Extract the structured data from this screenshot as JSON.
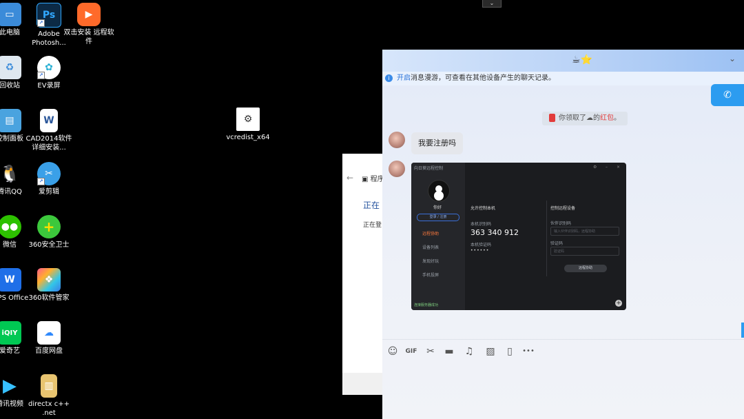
{
  "desktop": {
    "icons": [
      {
        "label": "此电脑",
        "icon": "computer-icon"
      },
      {
        "label": "Adobe Photosh...",
        "icon": "photoshop-icon"
      },
      {
        "label": "双击安装 远程软件",
        "icon": "remote-install-icon"
      },
      {
        "label": "回收站",
        "icon": "recycle-bin-icon"
      },
      {
        "label": "EV录屏",
        "icon": "ev-recorder-icon"
      },
      {
        "label": "控制面板",
        "icon": "control-panel-icon"
      },
      {
        "label": "CAD2014软件详细安装...",
        "icon": "word-doc-icon"
      },
      {
        "label": "vcredist_x64",
        "icon": "installer-icon"
      },
      {
        "label": "腾讯QQ",
        "icon": "qq-icon"
      },
      {
        "label": "爱剪辑",
        "icon": "video-editor-icon"
      },
      {
        "label": "微信",
        "icon": "wechat-icon"
      },
      {
        "label": "360安全卫士",
        "icon": "360-security-icon"
      },
      {
        "label": "WPS Office",
        "icon": "wps-icon"
      },
      {
        "label": "360软件管家",
        "icon": "360-software-icon"
      },
      {
        "label": "爱奇艺",
        "icon": "iqiyi-icon"
      },
      {
        "label": "百度网盘",
        "icon": "baidu-netdisk-icon"
      },
      {
        "label": "腾讯视频",
        "icon": "tencent-video-icon"
      },
      {
        "label": "directx c++ .net",
        "icon": "folder-archive-icon"
      }
    ]
  },
  "installer": {
    "title_fragment": "程序",
    "heading_fragment": "正在",
    "status_fragment": "正在登"
  },
  "chat": {
    "header_icons": "☕⭐",
    "notice": {
      "link": "开启",
      "text": "消息漫游，可查看在其他设备产生的聊天记录。"
    },
    "system_message": {
      "prefix": "你领取了",
      "suffix": "的",
      "red": "红包",
      "end": "。"
    },
    "message_text": "我要注册吗",
    "toolbar": [
      "emoji-icon",
      "gif-icon",
      "scissors-icon",
      "folder-icon",
      "music-icon",
      "image-icon",
      "screen-share-icon",
      "more-icon"
    ],
    "toolbar_labels": {
      "gif": "GIF",
      "more": "•••"
    }
  },
  "shared_screenshot": {
    "app_title": "向日葵远程控制",
    "greeting": "你好",
    "login_label": "登录 / 注册",
    "menu": [
      "远程协助",
      "设备列表",
      "发现好玩",
      "手机投屏"
    ],
    "allow_title": "允许控制本机",
    "id_label": "本机识别码",
    "id_value": "363 340 912",
    "code_label": "本机验证码",
    "code_value": "••••••",
    "control_title": "控制远程设备",
    "partner_label": "伙伴识别码",
    "partner_placeholder": "输入伙伴识别码，远程协助",
    "verify_label": "验证码",
    "verify_placeholder": "验证码",
    "connect_button": "远程协助",
    "status": "连接服务器成功"
  }
}
